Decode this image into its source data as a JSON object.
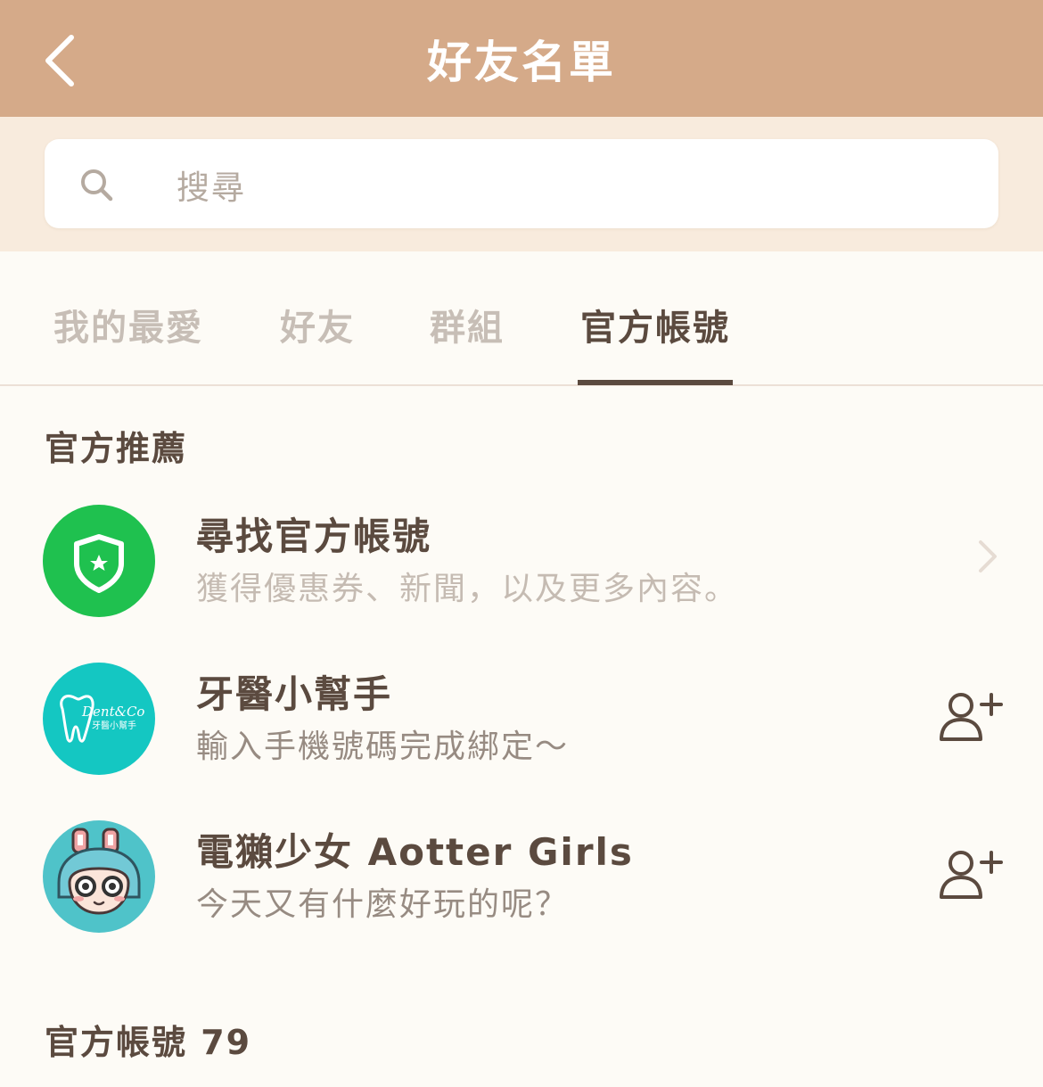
{
  "header": {
    "title": "好友名單",
    "back_icon": "chevron-left-icon"
  },
  "search": {
    "placeholder": "搜尋",
    "icon": "search-icon"
  },
  "tabs": [
    {
      "label": "我的最愛",
      "active": false
    },
    {
      "label": "好友",
      "active": false
    },
    {
      "label": "群組",
      "active": false
    },
    {
      "label": "官方帳號",
      "active": true
    }
  ],
  "sections": {
    "recommended": {
      "title": "官方推薦",
      "items": [
        {
          "title": "尋找官方帳號",
          "subtitle": "獲得優惠券、新聞，以及更多內容。",
          "action_icon": "chevron-right-icon",
          "avatar_icon": "shield-star-icon"
        },
        {
          "title": "牙醫小幫手",
          "subtitle": "輸入手機號碼完成綁定～",
          "action_icon": "add-friend-icon",
          "avatar_text_1": "Dent&Co",
          "avatar_text_2": "牙醫小幫手"
        },
        {
          "title": "電獺少女 Aotter Girls",
          "subtitle": "今天又有什麼好玩的呢？",
          "action_icon": "add-friend-icon",
          "avatar_icon": "anime-girl-avatar"
        }
      ]
    },
    "official": {
      "title": "官方帳號 79"
    }
  },
  "colors": {
    "header_bg": "#d5aa89",
    "search_band": "#f8ebdd",
    "page_bg": "#fdfbf6",
    "text_dark": "#5b4a3f",
    "line_green": "#1fc14f",
    "teal": "#14c7c2"
  }
}
